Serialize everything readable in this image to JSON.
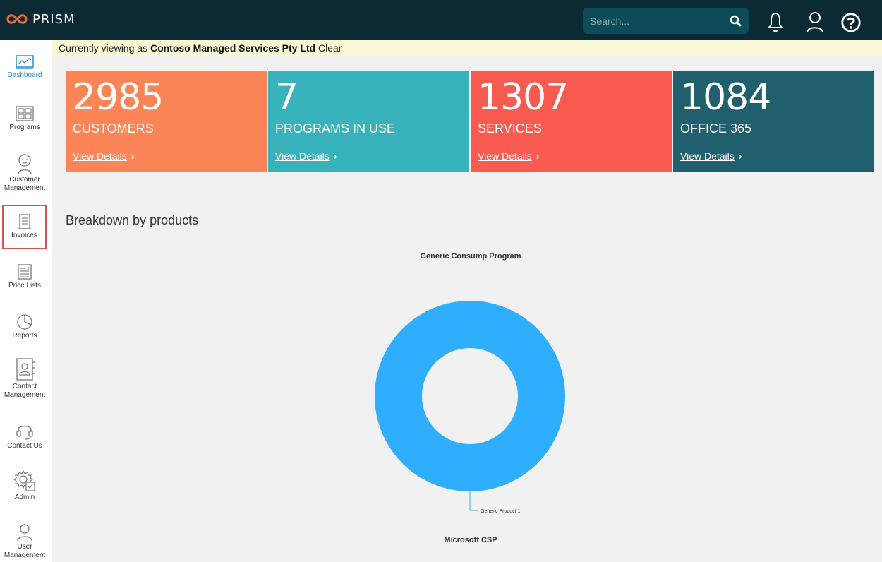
{
  "app": {
    "name": "PRISM"
  },
  "search": {
    "placeholder": "Search..."
  },
  "banner": {
    "prefix": "Currently viewing as",
    "company": "Contoso Managed Services Pty Ltd",
    "clear": "Clear"
  },
  "sidebar": {
    "items": [
      {
        "label": "Dashboard",
        "icon": "dashboard-chart-icon",
        "active": true
      },
      {
        "label": "Programs",
        "icon": "programs-grid-icon"
      },
      {
        "label": "Customer Management",
        "icon": "customer-face-icon"
      },
      {
        "label": "Invoices",
        "icon": "invoice-document-icon"
      },
      {
        "label": "Price Lists",
        "icon": "price-list-icon"
      },
      {
        "label": "Reports",
        "icon": "reports-pie-icon"
      },
      {
        "label": "Contact Management",
        "icon": "contact-book-icon"
      },
      {
        "label": "Contact Us",
        "icon": "headset-icon"
      },
      {
        "label": "Admin",
        "icon": "admin-gear-icon"
      },
      {
        "label": "User Management",
        "icon": "user-icon"
      }
    ]
  },
  "tiles": [
    {
      "value": "2985",
      "label": "CUSTOMERS",
      "link": "View Details",
      "color": "#fb8556"
    },
    {
      "value": "7",
      "label": "PROGRAMS IN USE",
      "link": "View Details",
      "color": "#38b2bb"
    },
    {
      "value": "1307",
      "label": "SERVICES",
      "link": "View Details",
      "color": "#fa5b51"
    },
    {
      "value": "1084",
      "label": "OFFICE 365",
      "link": "View Details",
      "color": "#20606e"
    }
  ],
  "breakdown": {
    "title": "Breakdown by products"
  },
  "chart_data": [
    {
      "type": "pie",
      "title": "Generic Consump Program",
      "categories": [
        "Generic Product 1"
      ],
      "values": [
        100
      ],
      "colors": [
        "#2eaefc"
      ]
    },
    {
      "type": "pie",
      "title": "Microsoft CSP",
      "categories": [],
      "values": []
    }
  ],
  "colors": {
    "topbar": "#0b2a33",
    "search_bg": "#0c4b58",
    "banner_bg": "#fbf8d6",
    "accent": "#2e8fc7"
  }
}
